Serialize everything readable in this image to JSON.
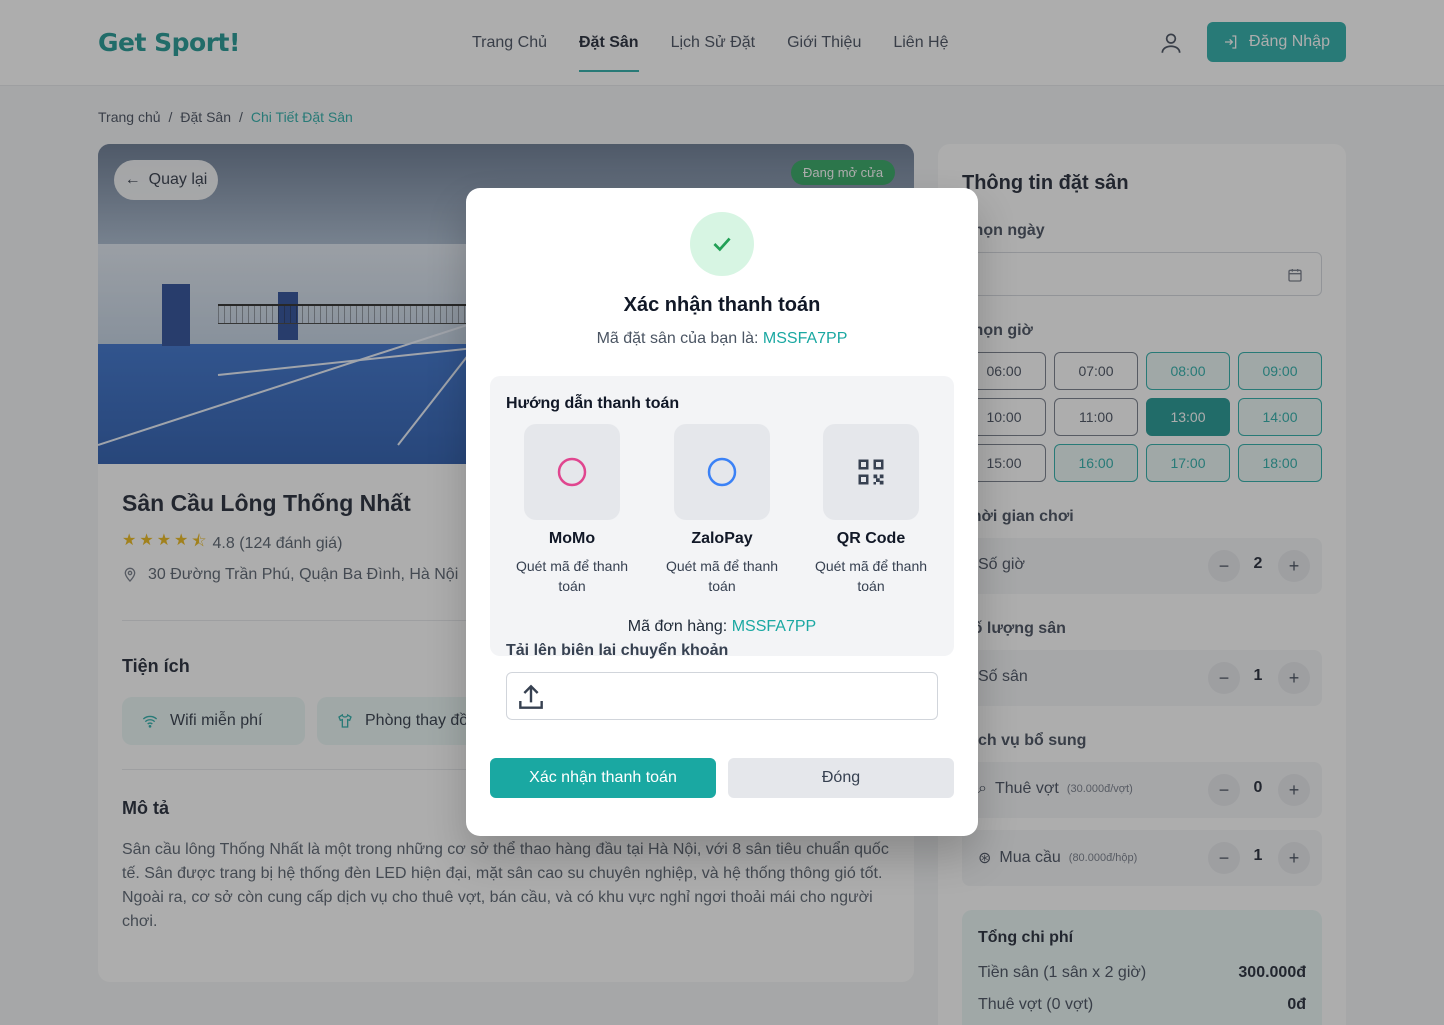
{
  "header": {
    "logo": "Get Sport!",
    "nav": [
      "Trang Chủ",
      "Đặt Sân",
      "Lịch Sử Đặt",
      "Giới Thiệu",
      "Liên Hệ"
    ],
    "active_nav": "Đặt Sân",
    "login_label": "Đăng Nhập"
  },
  "breadcrumb": {
    "home": "Trang chủ",
    "sep": "/",
    "booking": "Đặt Sân",
    "current": "Chi Tiết Đặt Sân"
  },
  "venue": {
    "back_label": "Quay lại",
    "status": "Đang mở cửa",
    "name": "Sân Cầu Lông Thống Nhất",
    "rating": 4.5,
    "rating_text": "4.8 (124 đánh giá)",
    "address": "30 Đường Trần Phú, Quận Ba Đình, Hà Nội",
    "amenities_title": "Tiện ích",
    "amenities": [
      "Wifi miễn phí",
      "Phòng thay đồ"
    ],
    "description_title": "Mô tả",
    "description": "Sân cầu lông Thống Nhất là một trong những cơ sở thể thao hàng đầu tại Hà Nội, với 8 sân tiêu chuẩn quốc tế. Sân được trang bị hệ thống đèn LED hiện đại, mặt sân cao su chuyên nghiệp, và hệ thống thông gió tốt. Ngoài ra, cơ sở còn cung cấp dịch vụ cho thuê vợt, bán cầu, và có khu vực nghỉ ngơi thoải mái cho người chơi."
  },
  "booking": {
    "title": "Thông tin đặt sân",
    "date_label": "Chọn ngày",
    "time_label": "Chọn giờ",
    "slots": [
      {
        "time": "06:00",
        "state": "na"
      },
      {
        "time": "07:00",
        "state": "na"
      },
      {
        "time": "08:00",
        "state": "av"
      },
      {
        "time": "09:00",
        "state": "av"
      },
      {
        "time": "10:00",
        "state": "na"
      },
      {
        "time": "11:00",
        "state": "na"
      },
      {
        "time": "13:00",
        "state": "sel"
      },
      {
        "time": "14:00",
        "state": "av"
      },
      {
        "time": "15:00",
        "state": "na"
      },
      {
        "time": "16:00",
        "state": "av"
      },
      {
        "time": "17:00",
        "state": "av"
      },
      {
        "time": "18:00",
        "state": "av"
      }
    ],
    "duration_label": "Thời gian chơi",
    "hours_label": "Số giờ",
    "hours_value": "2",
    "courts_section": "Số lượng sân",
    "courts_label": "Số sân",
    "courts_value": "1",
    "extras_label": "Dịch vụ bổ sung",
    "racket_label": "Thuê vợt",
    "racket_price": "(30.000đ/vợt)",
    "racket_value": "0",
    "shuttle_label": "Mua cầu",
    "shuttle_price": "(80.000đ/hộp)",
    "shuttle_value": "1",
    "minus": "−",
    "plus": "+",
    "cost_title": "Tổng chi phí",
    "cost_rows": [
      {
        "label": "Tiền sân (1 sân x 2 giờ)",
        "value": "300.000đ"
      },
      {
        "label": "Thuê vợt (0 vợt)",
        "value": "0đ"
      }
    ]
  },
  "modal": {
    "title": "Xác nhận thanh toán",
    "code_prefix": "Mã đặt sân của bạn là:",
    "code": "MSSFA7PP",
    "guide_title": "Hướng dẫn thanh toán",
    "methods": [
      {
        "name": "MoMo",
        "desc": "Quét mã để thanh toán",
        "icon": "momo-icon",
        "color": "#e0468f"
      },
      {
        "name": "ZaloPay",
        "desc": "Quét mã để thanh toán",
        "icon": "zalopay-icon",
        "color": "#3b82f6"
      },
      {
        "name": "QR Code",
        "desc": "Quét mã để thanh toán",
        "icon": "qr-code-icon",
        "color": "#374151"
      }
    ],
    "order_prefix": "Mã đơn hàng:",
    "order_code": "MSSFA7PP",
    "upload_label": "Tải lên biên lai chuyển khoản",
    "confirm_label": "Xác nhận thanh toán",
    "close_label": "Đóng"
  }
}
